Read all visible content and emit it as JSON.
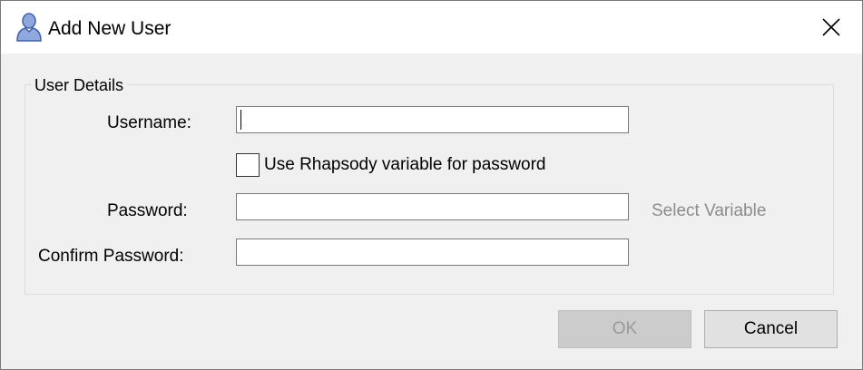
{
  "window": {
    "title": "Add New User",
    "title_icon": "user-icon",
    "close_icon": "close-icon"
  },
  "group": {
    "label": "User Details"
  },
  "fields": {
    "username": {
      "label": "Username:",
      "value": ""
    },
    "use_variable": {
      "label": "Use Rhapsody variable for password",
      "checked": false
    },
    "password": {
      "label": "Password:",
      "value": ""
    },
    "select_variable": "Select Variable",
    "confirm_password": {
      "label": "Confirm Password:",
      "value": ""
    }
  },
  "buttons": {
    "ok": "OK",
    "cancel": "Cancel"
  },
  "colors": {
    "dialog_bg": "#f0f0f0",
    "titlebar_bg": "#ffffff",
    "user_icon": "#6a86c7",
    "disabled_text": "#8c8c8c"
  }
}
